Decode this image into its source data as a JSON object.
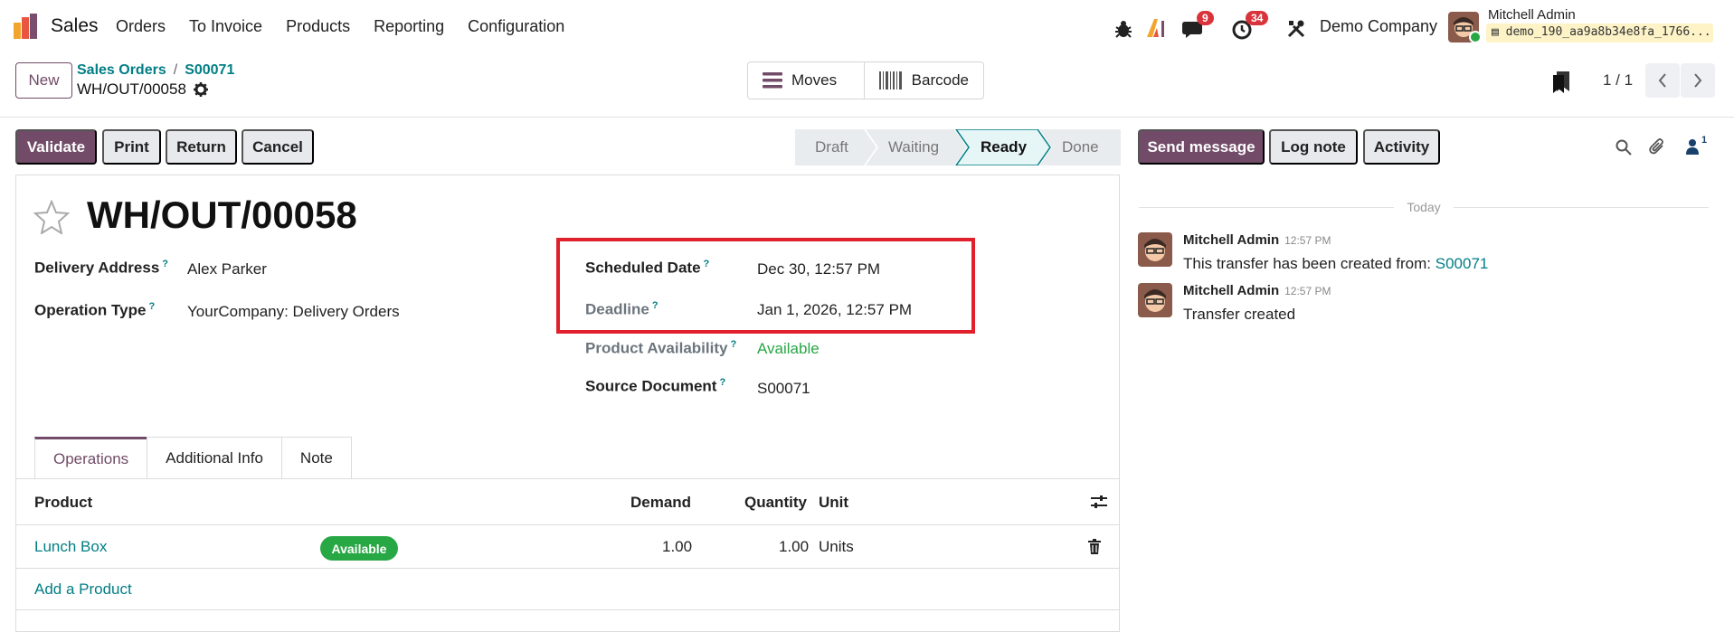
{
  "navbar": {
    "app_name": "Sales",
    "menu": [
      "Orders",
      "To Invoice",
      "Products",
      "Reporting",
      "Configuration"
    ],
    "messages_count": "9",
    "activities_count": "34",
    "company": "Demo Company",
    "user_name": "Mitchell Admin",
    "db_name": "demo_190_aa9a8b34e8fa_1766..."
  },
  "control_panel": {
    "new_label": "New",
    "breadcrumb": [
      "Sales Orders",
      "S00071"
    ],
    "record_name": "WH/OUT/00058",
    "smart_buttons": {
      "moves": "Moves",
      "barcode": "Barcode"
    },
    "pager": "1 / 1"
  },
  "actions": {
    "validate": "Validate",
    "print": "Print",
    "return": "Return",
    "cancel": "Cancel"
  },
  "stages": {
    "draft": "Draft",
    "waiting": "Waiting",
    "ready": "Ready",
    "done": "Done",
    "current": "Ready"
  },
  "form": {
    "title": "WH/OUT/00058",
    "delivery_address_label": "Delivery Address",
    "delivery_address": "Alex Parker",
    "operation_type_label": "Operation Type",
    "operation_type": "YourCompany: Delivery Orders",
    "scheduled_date_label": "Scheduled Date",
    "scheduled_date": "Dec 30, 12:57 PM",
    "deadline_label": "Deadline",
    "deadline": "Jan 1, 2026, 12:57 PM",
    "availability_label": "Product Availability",
    "availability": "Available",
    "source_label": "Source Document",
    "source": "S00071",
    "help_mark": "?"
  },
  "tabs": [
    "Operations",
    "Additional Info",
    "Note"
  ],
  "table": {
    "headers": {
      "product": "Product",
      "demand": "Demand",
      "quantity": "Quantity",
      "unit": "Unit"
    },
    "rows": [
      {
        "product": "Lunch Box",
        "status": "Available",
        "demand": "1.00",
        "quantity": "1.00",
        "unit": "Units"
      }
    ],
    "add_label": "Add a Product"
  },
  "chatter": {
    "send_message": "Send message",
    "log_note": "Log note",
    "activity": "Activity",
    "followers_count": "1",
    "date_separator": "Today",
    "messages": [
      {
        "author": "Mitchell Admin",
        "time": "12:57 PM",
        "body": "This transfer has been created from: ",
        "link": "S00071"
      },
      {
        "author": "Mitchell Admin",
        "time": "12:57 PM",
        "body": "Transfer created"
      }
    ]
  },
  "colors": {
    "brand": "#714b67",
    "link": "#017e84",
    "success": "#28a745",
    "highlight": "#e0202b",
    "badge": "#d9343c"
  }
}
